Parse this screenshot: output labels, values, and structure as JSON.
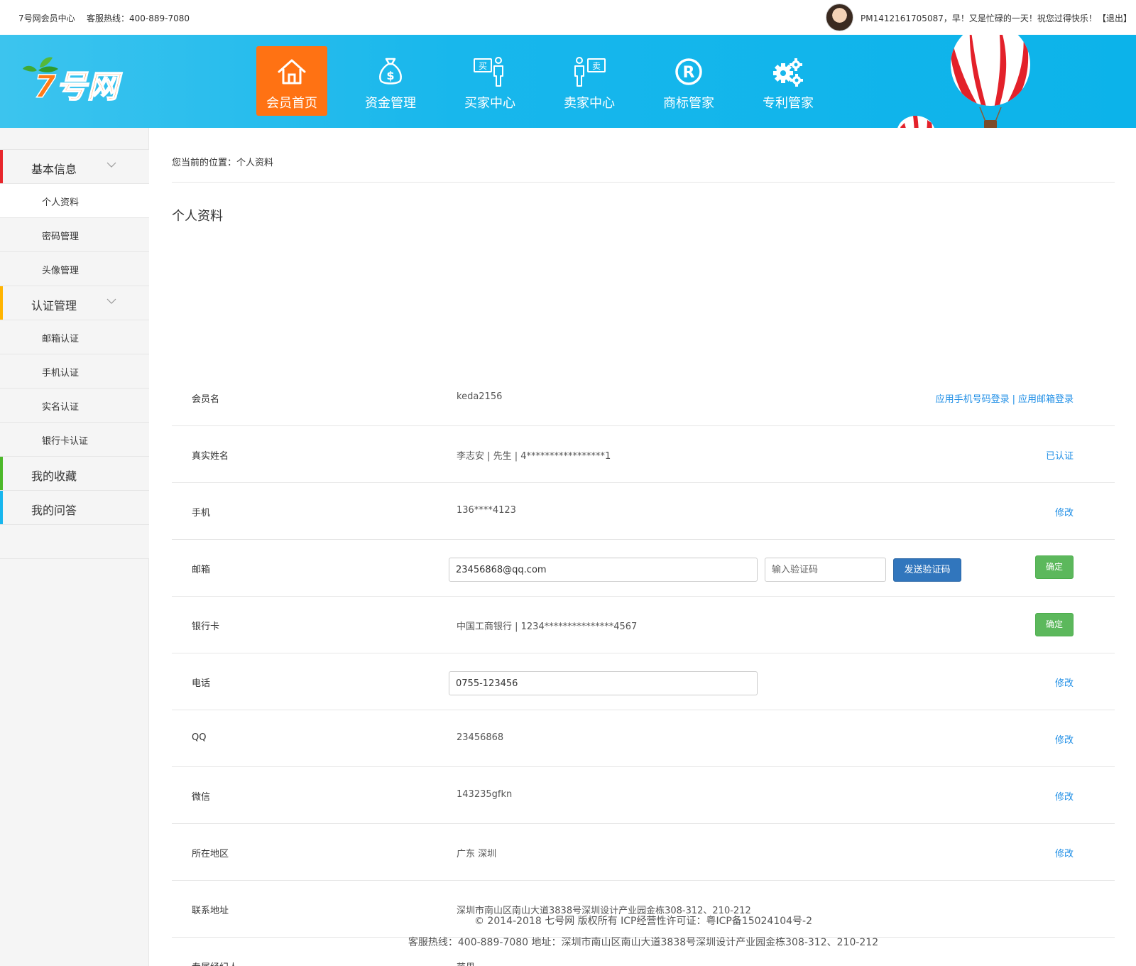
{
  "topbar": {
    "site_name": "7号网会员中心",
    "hotline": "客服热线：400-889-7080",
    "greeting": "PM1412161705087，早！又是忙碌的一天！祝您过得快乐！",
    "logout": "【退出】"
  },
  "nav": [
    {
      "label": "会员首页",
      "icon": "home-icon",
      "active": true
    },
    {
      "label": "资金管理",
      "icon": "money-bag-icon",
      "active": false
    },
    {
      "label": "买家中心",
      "icon": "buyer-icon",
      "active": false
    },
    {
      "label": "卖家中心",
      "icon": "seller-icon",
      "active": false
    },
    {
      "label": "商标管家",
      "icon": "registered-trademark-icon",
      "active": false
    },
    {
      "label": "专利管家",
      "icon": "gears-icon",
      "active": false
    }
  ],
  "colors": {
    "header_blue": "#0cb3ea",
    "nav_active": "#ff7213",
    "link_blue": "#1e8ee6",
    "btn_blue": "#3176bd",
    "btn_green": "#5cb85c",
    "group_red": "#e8262b",
    "group_orange": "#ffb400",
    "group_green": "#4cb82a",
    "group_cyan": "#17b6ee"
  },
  "sidebar": {
    "basic": {
      "label": "基本信息",
      "items": [
        "个人资料",
        "密码管理",
        "头像管理"
      ]
    },
    "auth": {
      "label": "认证管理",
      "items": [
        "邮箱认证",
        "手机认证",
        "实名认证",
        "银行卡认证"
      ]
    },
    "favorites": "我的收藏",
    "qa": "我的问答"
  },
  "breadcrumb": "您当前的位置：个人资料",
  "page_title": "个人资料",
  "rows": {
    "member": {
      "label": "会员名",
      "value": "keda2156",
      "act1": "应用手机号码登录",
      "sep": "|",
      "act2": "应用邮箱登录"
    },
    "realname": {
      "label": "真实姓名",
      "value": "李志安 | 先生 | 4*****************1",
      "act": "已认证"
    },
    "mobile": {
      "label": "手机",
      "value": "136****4123",
      "act": "修改"
    },
    "email": {
      "label": "邮箱",
      "value": "23456868@qq.com",
      "code_placeholder": "输入验证码",
      "send": "发送验证码",
      "confirm": "确定"
    },
    "bank": {
      "label": "银行卡",
      "value": "中国工商银行 | 1234***************4567",
      "confirm": "确定"
    },
    "phone": {
      "label": "电话",
      "value": "0755-123456",
      "act": "修改"
    },
    "qq": {
      "label": "QQ",
      "value": "23456868",
      "act": "修改"
    },
    "wechat": {
      "label": "微信",
      "value": "143235gfkn",
      "act": "修改"
    },
    "region": {
      "label": "所在地区",
      "value": "广东 深圳",
      "act": "修改"
    },
    "address": {
      "label": "联系地址",
      "value": "深圳市南山区南山大道3838号深圳设计产业园金栋308-312、210-212"
    },
    "agent": {
      "label": "专属经纪人",
      "value": "苹果"
    }
  },
  "footer": {
    "line1": "© 2014-2018 七号网 版权所有 ICP经营性许可证：粤ICP备15024104号-2",
    "line2": "客服热线：400-889-7080  地址：深圳市南山区南山大道3838号深圳设计产业园金栋308-312、210-212"
  }
}
